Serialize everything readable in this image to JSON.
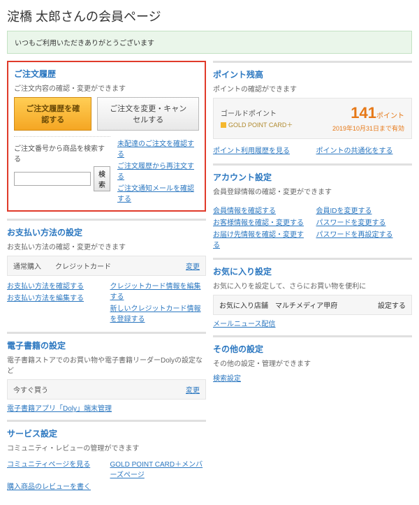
{
  "page_title": "淀橋 太郎さんの会員ページ",
  "notice": "いつもご利用いただきありがとうございます",
  "order": {
    "title": "ご注文履歴",
    "sub": "ご注文内容の確認・変更ができます",
    "confirm_btn": "ご注文履歴を確認する",
    "change_btn": "ご注文を変更・キャンセルする",
    "search_label": "ご注文番号から商品を検索する",
    "search_btn": "検索",
    "links": [
      "未配達のご注文を確認する",
      "ご注文履歴から再注文する",
      "ご注文通知メールを確認する"
    ]
  },
  "point": {
    "title": "ポイント残高",
    "sub": "ポイントの確認ができます",
    "gold_label": "ゴールドポイント",
    "card_label": "GOLD POINT CARD＋",
    "value": "141",
    "unit": "ポイント",
    "expiry": "2019年10月31日まで有効",
    "links": [
      "ポイント利用履歴を見る",
      "ポイントの共通化をする"
    ]
  },
  "payment": {
    "title": "お支払い方法の設定",
    "sub": "お支払い方法の確認・変更ができます",
    "box_left": "通常購入",
    "box_mid": "クレジットカード",
    "box_link": "変更",
    "links_l": [
      "お支払い方法を確認する",
      "お支払い方法を編集する"
    ],
    "links_r": [
      "クレジットカード情報を編集する",
      "新しいクレジットカード情報を登録する"
    ]
  },
  "account": {
    "title": "アカウント設定",
    "sub": "会員登録情報の確認・変更ができます",
    "links_l": [
      "会員情報を確認する",
      "お客様情報を確認・変更する",
      "お届け先情報を確認・変更する"
    ],
    "links_r": [
      "会員IDを変更する",
      "パスワードを変更する",
      "パスワードを再設定する"
    ]
  },
  "ebook": {
    "title": "電子書籍の設定",
    "sub": "電子書籍ストアでのお買い物や電子書籍リーダーDolyの設定など",
    "box_left": "今すぐ買う",
    "box_link": "変更",
    "link": "電子書籍アプリ「Doly」端末管理"
  },
  "favorite": {
    "title": "お気に入り設定",
    "sub": "お気に入りを設定して、さらにお買い物を便利に",
    "box_left": "お気に入り店舗",
    "box_mid": "マルチメディア甲府",
    "box_link": "設定する",
    "link": "メールニュース配信"
  },
  "service": {
    "title": "サービス設定",
    "sub": "コミュニティ・レビューの管理ができます",
    "links": [
      "コミュニティページを見る",
      "GOLD POINT CARD＋メンバーズページ"
    ],
    "link2": "購入商品のレビューを書く"
  },
  "other": {
    "title": "その他の設定",
    "sub": "その他の設定・管理ができます",
    "link": "検索設定"
  }
}
